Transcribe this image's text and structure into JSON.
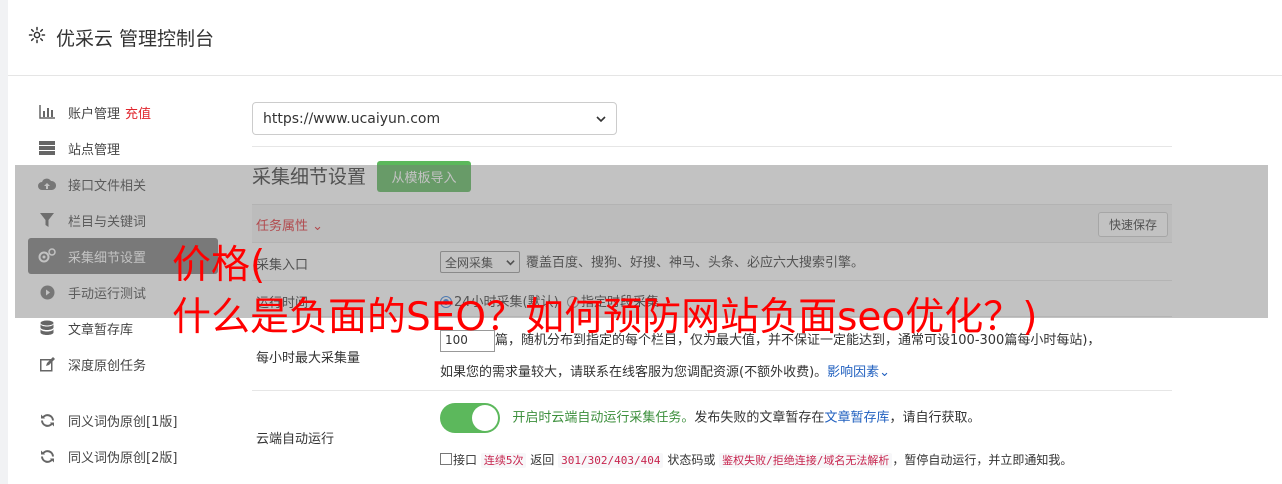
{
  "header": {
    "title": "优采云 管理控制台",
    "icon": "gear-icon"
  },
  "sidebar": {
    "items": [
      {
        "label": "账户管理",
        "badge": "充值",
        "icon": "bar-chart-icon"
      },
      {
        "label": "站点管理",
        "icon": "server-icon"
      },
      {
        "label": "接口文件相关",
        "icon": "cloud-upload-icon"
      },
      {
        "label": "栏目与关键词",
        "icon": "filter-icon"
      },
      {
        "label": "采集细节设置",
        "icon": "gears-icon",
        "active": true
      },
      {
        "label": "手动运行测试",
        "icon": "play-circle-icon"
      },
      {
        "label": "文章暂存库",
        "icon": "database-icon"
      },
      {
        "label": "深度原创任务",
        "icon": "edit-icon"
      },
      {
        "label": "同义词伪原创[1版]",
        "icon": "refresh-icon"
      },
      {
        "label": "同义词伪原创[2版]",
        "icon": "refresh-icon"
      }
    ]
  },
  "main": {
    "site_select": "https://www.ucaiyun.com",
    "section_title": "采集细节设置",
    "template_button": "从模板导入",
    "task_label": "任务属性",
    "quick_save": "快速保存",
    "rows": {
      "entry": {
        "label": "采集入口",
        "select": "全网采集",
        "desc": "覆盖百度、搜狗、好搜、神马、头条、必应六大搜索引擎。"
      },
      "runtime": {
        "label": "运行时间",
        "opt1": "24小时采集(默认)",
        "opt2": "指定时段采集"
      },
      "max": {
        "label": "每小时最大采集量",
        "value": "100",
        "line1": "篇，随机分布到指定的每个栏目，仅为最大值，并不保证一定能达到，通常可设100-300篇每小时每站)，",
        "line2": "如果您的需求量较大，请联系在线客服为您调配资源(不额外收费)。",
        "link": "影响因素"
      },
      "cloud": {
        "label": "云端自动运行",
        "on_text": "开启时云端自动运行采集任务。",
        "desc_a": "发布失败的文章暂存在",
        "desc_link": "文章暂存库",
        "desc_b": "，请自行获取。",
        "cb_a": "接口",
        "cb_code1": "连续5次",
        "cb_b": "返回",
        "cb_code2": "301/302/403/404",
        "cb_c": "状态码或",
        "cb_code3": "鉴权失败/拒绝连接/域名无法解析",
        "cb_d": "，暂停自动运行，并立即通知我。"
      }
    }
  },
  "overlay": {
    "line1": "价格(",
    "line2": "什么是负面的SEO？如何预防网站负面seo优化？)"
  }
}
